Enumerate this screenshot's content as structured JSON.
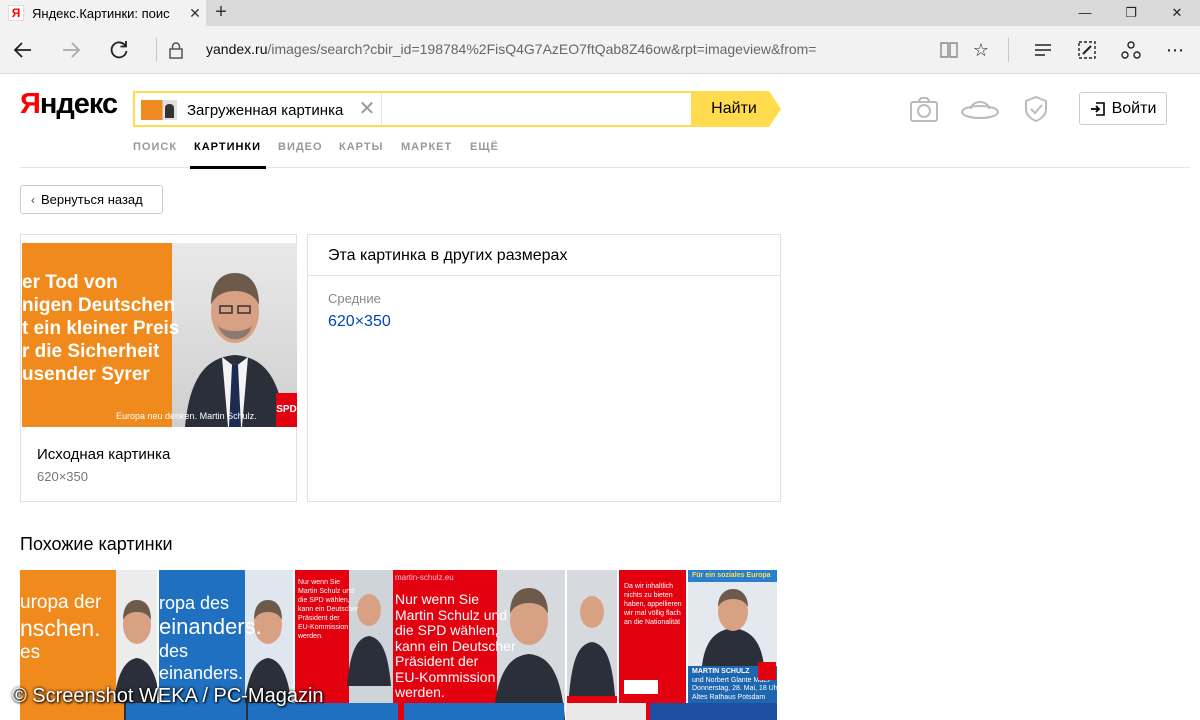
{
  "browser": {
    "tab_title": "Яндекс.Картинки: поис",
    "tab_favicon": "Я",
    "url_host": "yandex.ru",
    "url_path": "/images/search?cbir_id=198784%2FisQ4G7AzEO7ftQab8Z46ow&rpt=imageview&from="
  },
  "header": {
    "logo_first": "Я",
    "logo_rest": "ндекс",
    "search_chip_label": "Загруженная картинка",
    "search_button": "Найти",
    "login_label": "Войти",
    "services": [
      {
        "label": "ПОИСК",
        "active": false
      },
      {
        "label": "КАРТИНКИ",
        "active": true
      },
      {
        "label": "ВИДЕО",
        "active": false
      },
      {
        "label": "КАРТЫ",
        "active": false
      },
      {
        "label": "МАРКЕТ",
        "active": false
      },
      {
        "label": "ЕЩЁ",
        "active": false
      }
    ]
  },
  "main": {
    "back_button": "Вернуться назад",
    "original": {
      "image_text_lines": [
        "er Tod von",
        "nigen Deutschen",
        "t ein kleiner Preis",
        "r die Sicherheit",
        "usender Syrer"
      ],
      "image_footer": "Europa neu denken. Martin Schulz.",
      "image_badge": "SPD",
      "title": "Исходная картинка",
      "size": "620×350"
    },
    "sizes": {
      "title": "Эта картинка в других размерах",
      "category": "Средние",
      "link": "620×350"
    },
    "similar": {
      "title": "Похожие картинки",
      "thumbs": [
        {
          "lines": [
            "uropa der",
            "nschen.",
            "es"
          ]
        },
        {
          "lines": [
            "ropa des",
            "einanders.",
            "des",
            "einanders."
          ]
        },
        {
          "lines": [
            "Nur wenn Sie",
            "Martin Schulz und",
            "die SPD wählen,",
            "kann ein Deutscher",
            "Präsident der",
            "EU-Kommission",
            "werden."
          ]
        },
        {
          "lines": [
            "martin-schulz.eu",
            "Nur wenn Sie",
            "Martin Schulz und",
            "die SPD wählen,",
            "kann ein Deutscher",
            "Präsident der",
            "EU-Kommission",
            "werden."
          ]
        },
        {
          "lines": []
        },
        {
          "lines": [
            "Da wir inhaltlich",
            "nichts zu bieten",
            "haben, appellieren",
            "wir mal völlig flach",
            "an die Nationalität"
          ]
        },
        {
          "lines": [
            "Für ein soziales Europa",
            "MARTIN SCHULZ",
            "und Norbert Glante MdEP",
            "Donnerstag, 28. Mai, 18 Uhr",
            "Altes Rathaus Potsdam"
          ]
        }
      ]
    }
  },
  "watermark": "© Screenshot WEKA / PC-Magazin",
  "colors": {
    "search_yellow": "#ffdb4d",
    "logo_red": "#ff0000",
    "link_blue": "#0044bb",
    "spd_red": "#e3000f",
    "orange": "#f08a1c"
  }
}
